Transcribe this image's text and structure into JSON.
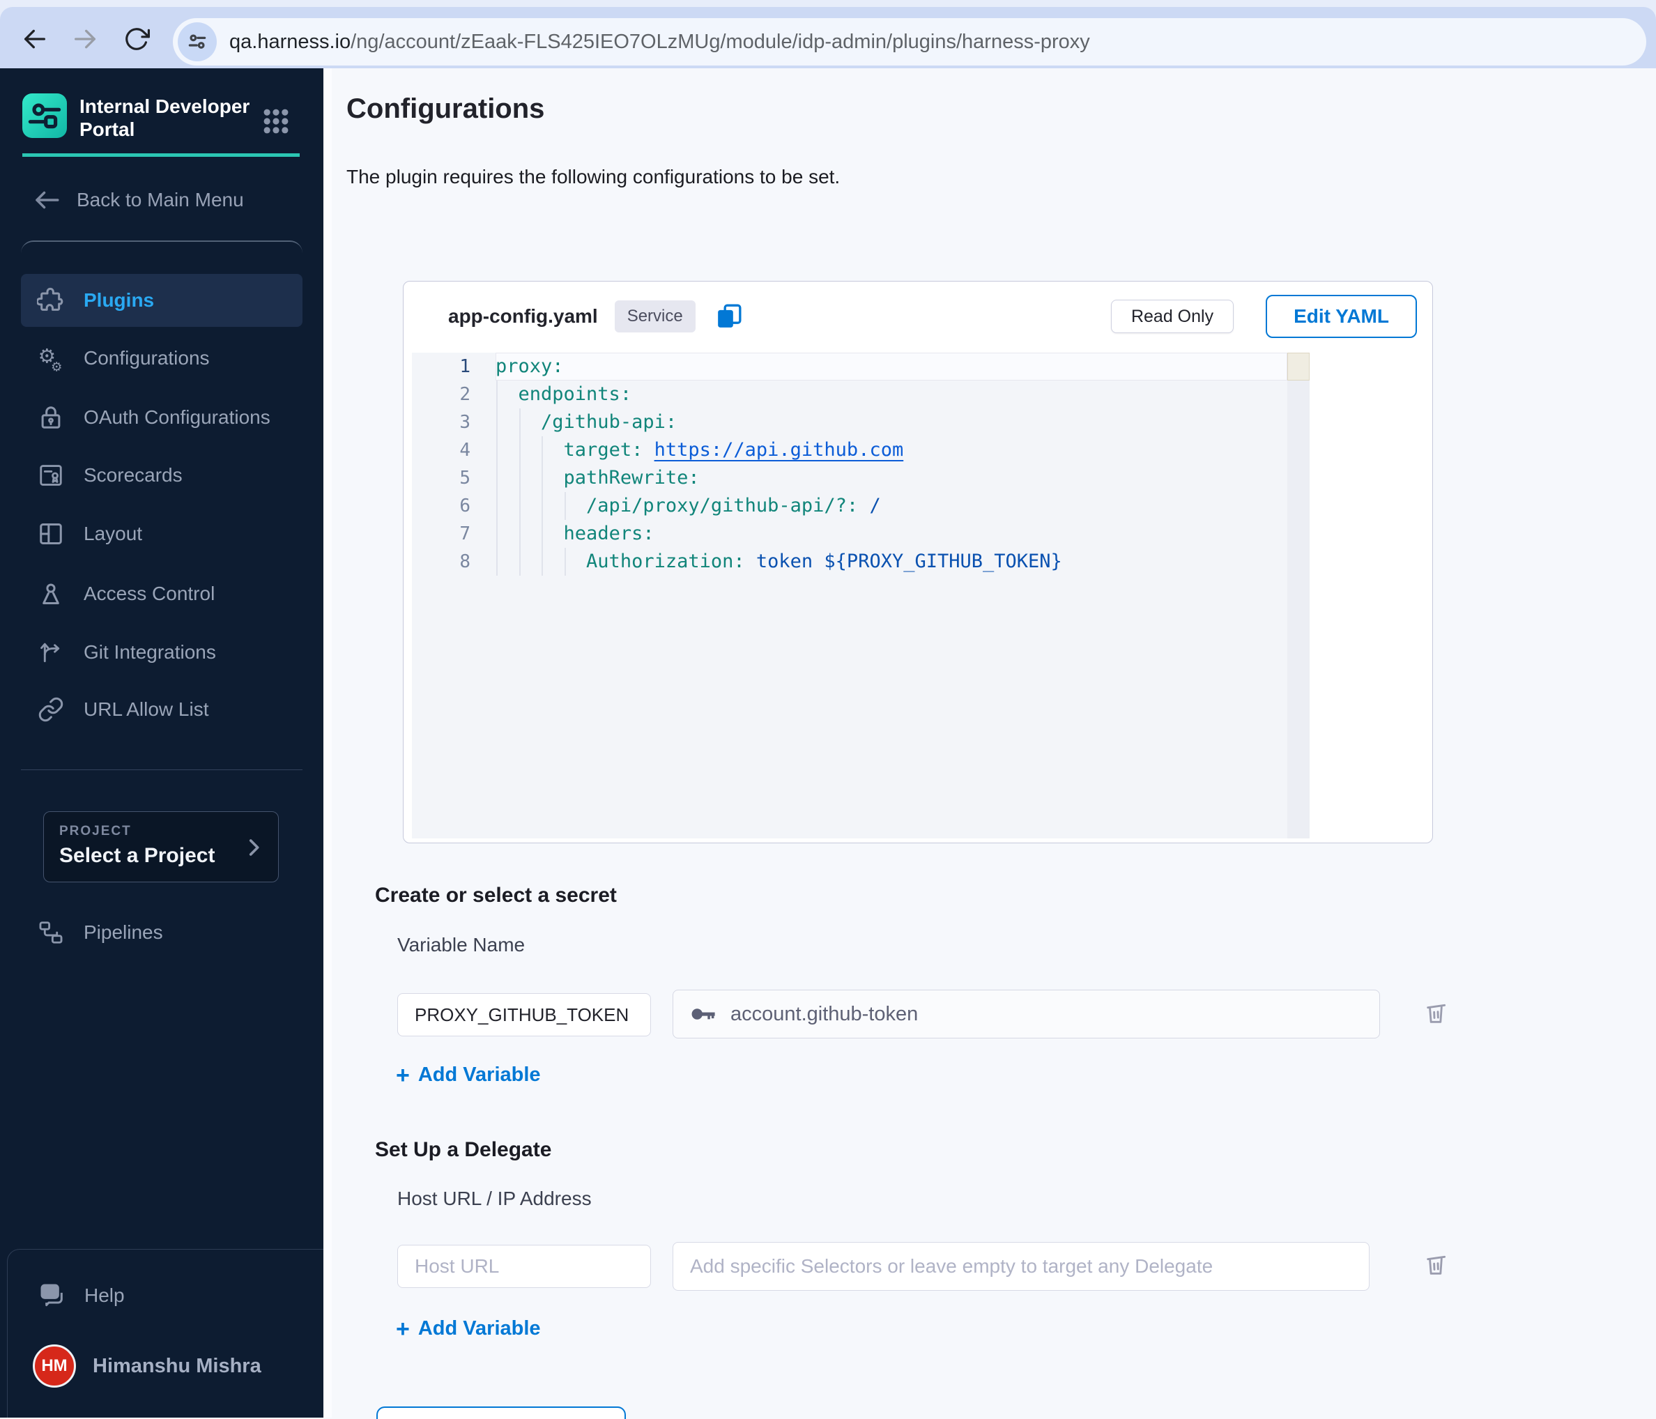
{
  "browser": {
    "url_domain": "qa.harness.io",
    "url_path": "/ng/account/zEaak-FLS425IEO7OLzMUg/module/idp-admin/plugins/harness-proxy"
  },
  "sidebar": {
    "brand_line1": "Internal Developer",
    "brand_line2": "Portal",
    "back_label": "Back to Main Menu",
    "items": [
      {
        "label": "Plugins",
        "active": true
      },
      {
        "label": "Configurations",
        "active": false
      },
      {
        "label": "OAuth Configurations",
        "active": false
      },
      {
        "label": "Scorecards",
        "active": false
      },
      {
        "label": "Layout",
        "active": false
      },
      {
        "label": "Access Control",
        "active": false
      },
      {
        "label": "Git Integrations",
        "active": false
      },
      {
        "label": "URL Allow List",
        "active": false
      }
    ],
    "project": {
      "label": "PROJECT",
      "value": "Select a Project"
    },
    "pipelines_label": "Pipelines",
    "help_label": "Help",
    "user": {
      "initials": "HM",
      "name": "Himanshu Mishra"
    }
  },
  "main": {
    "title": "Configurations",
    "subtitle": "The plugin requires the following configurations to be set.",
    "editor": {
      "filename": "app-config.yaml",
      "badge": "Service",
      "read_only_label": "Read Only",
      "edit_yaml_label": "Edit YAML",
      "lines": [
        {
          "num": "1",
          "indent": "",
          "key": "proxy:",
          "value": ""
        },
        {
          "num": "2",
          "indent": "  ",
          "key": "endpoints:",
          "value": ""
        },
        {
          "num": "3",
          "indent": "    ",
          "key": "/github-api:",
          "value": ""
        },
        {
          "num": "4",
          "indent": "      ",
          "key": "target: ",
          "value": "https://api.github.com"
        },
        {
          "num": "5",
          "indent": "      ",
          "key": "pathRewrite:",
          "value": ""
        },
        {
          "num": "6",
          "indent": "        ",
          "key": "/api/proxy/github-api/?: ",
          "value": "/"
        },
        {
          "num": "7",
          "indent": "      ",
          "key": "headers:",
          "value": ""
        },
        {
          "num": "8",
          "indent": "        ",
          "key": "Authorization: ",
          "value": "token ${PROXY_GITHUB_TOKEN}"
        }
      ]
    },
    "secret_section": {
      "heading": "Create or select a secret",
      "field_label": "Variable Name",
      "variable_name": "PROXY_GITHUB_TOKEN",
      "secret_value": "account.github-token",
      "add_variable_label": "Add Variable",
      "plus": "+"
    },
    "delegate_section": {
      "heading": "Set Up a Delegate",
      "field_label": "Host URL / IP Address",
      "host_placeholder": "Host URL",
      "selectors_placeholder": "Add specific Selectors or leave empty to target any Delegate",
      "add_variable_label": "Add Variable",
      "plus": "+"
    }
  },
  "colors": {
    "accent_blue": "#0278d5",
    "teal_accent": "#2bc6b3",
    "sidebar_bg": "#0d1c31",
    "avatar_red": "#d6281a",
    "code_key": "#11857a",
    "code_value": "#0a51b0"
  }
}
